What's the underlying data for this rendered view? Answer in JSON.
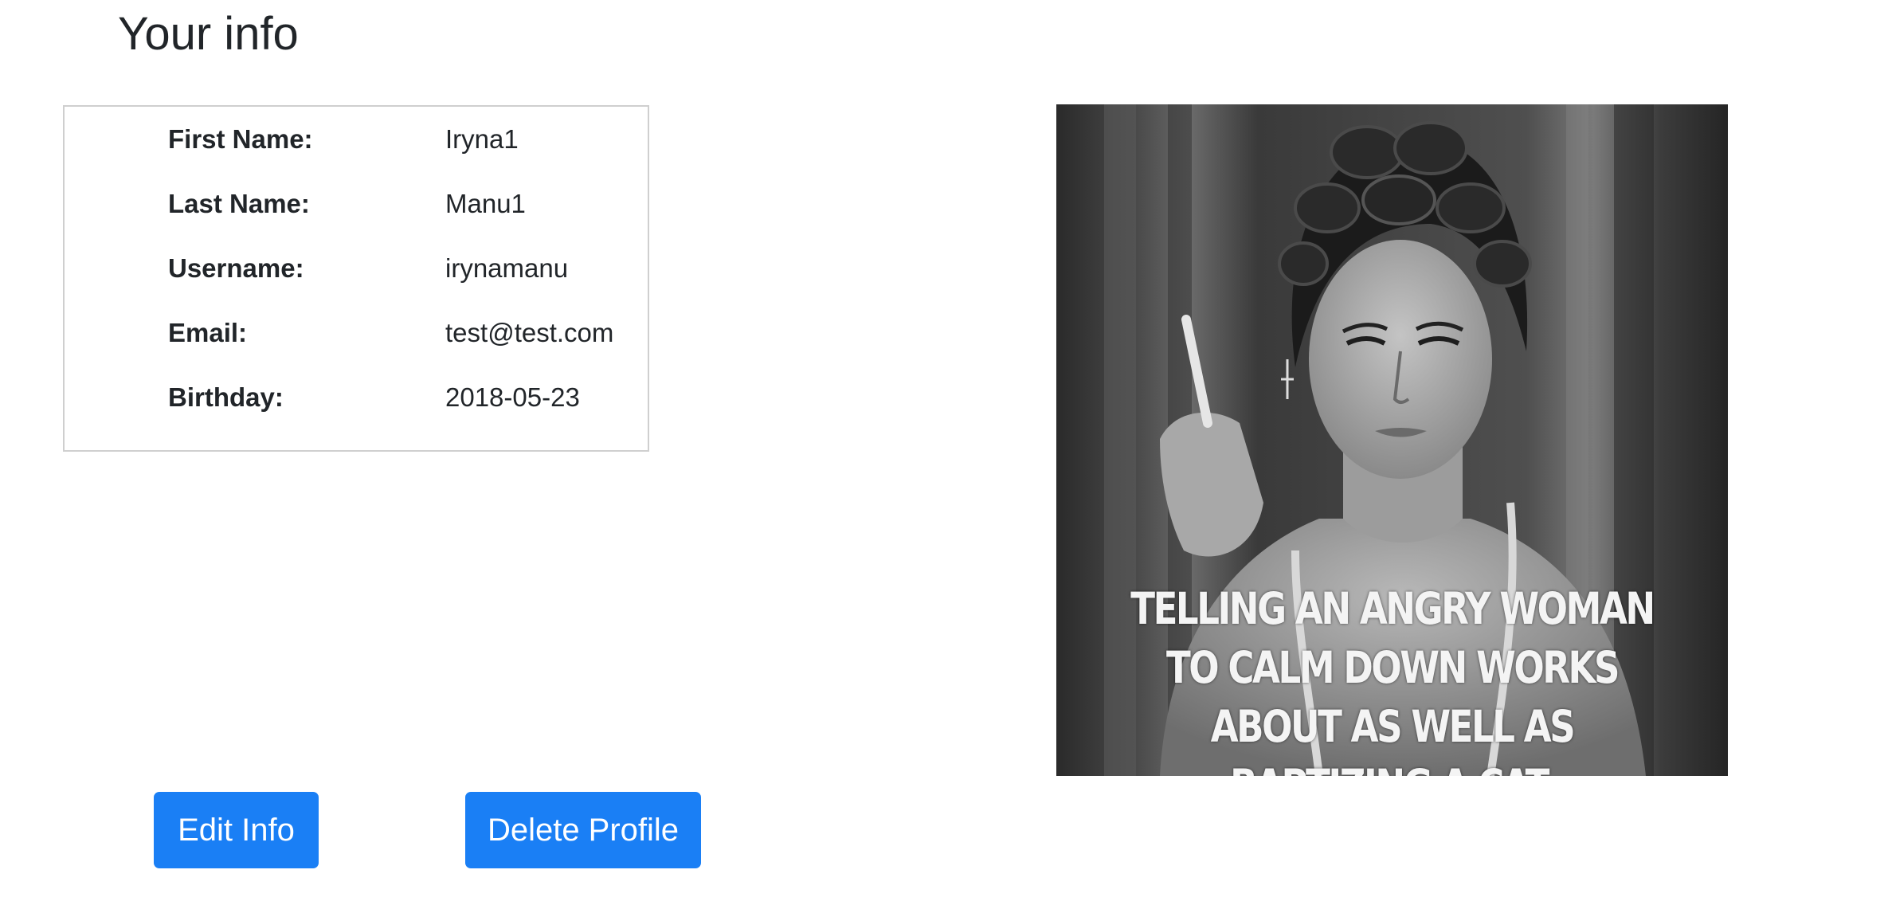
{
  "page": {
    "title": "Your info"
  },
  "profile": {
    "fields": [
      {
        "label": "First Name:",
        "value": "Iryna1"
      },
      {
        "label": "Last Name:",
        "value": "Manu1"
      },
      {
        "label": "Username:",
        "value": "irynamanu"
      },
      {
        "label": "Email:",
        "value": "test@test.com"
      },
      {
        "label": "Birthday:",
        "value": "2018-05-23"
      }
    ]
  },
  "actions": {
    "edit_label": "Edit Info",
    "delete_label": "Delete Profile",
    "accent_color": "#1a7ff5"
  },
  "profile_image": {
    "caption": "TELLING AN ANGRY WOMAN TO CALM DOWN WORKS ABOUT AS WELL AS BAPTIZING A CAT."
  }
}
